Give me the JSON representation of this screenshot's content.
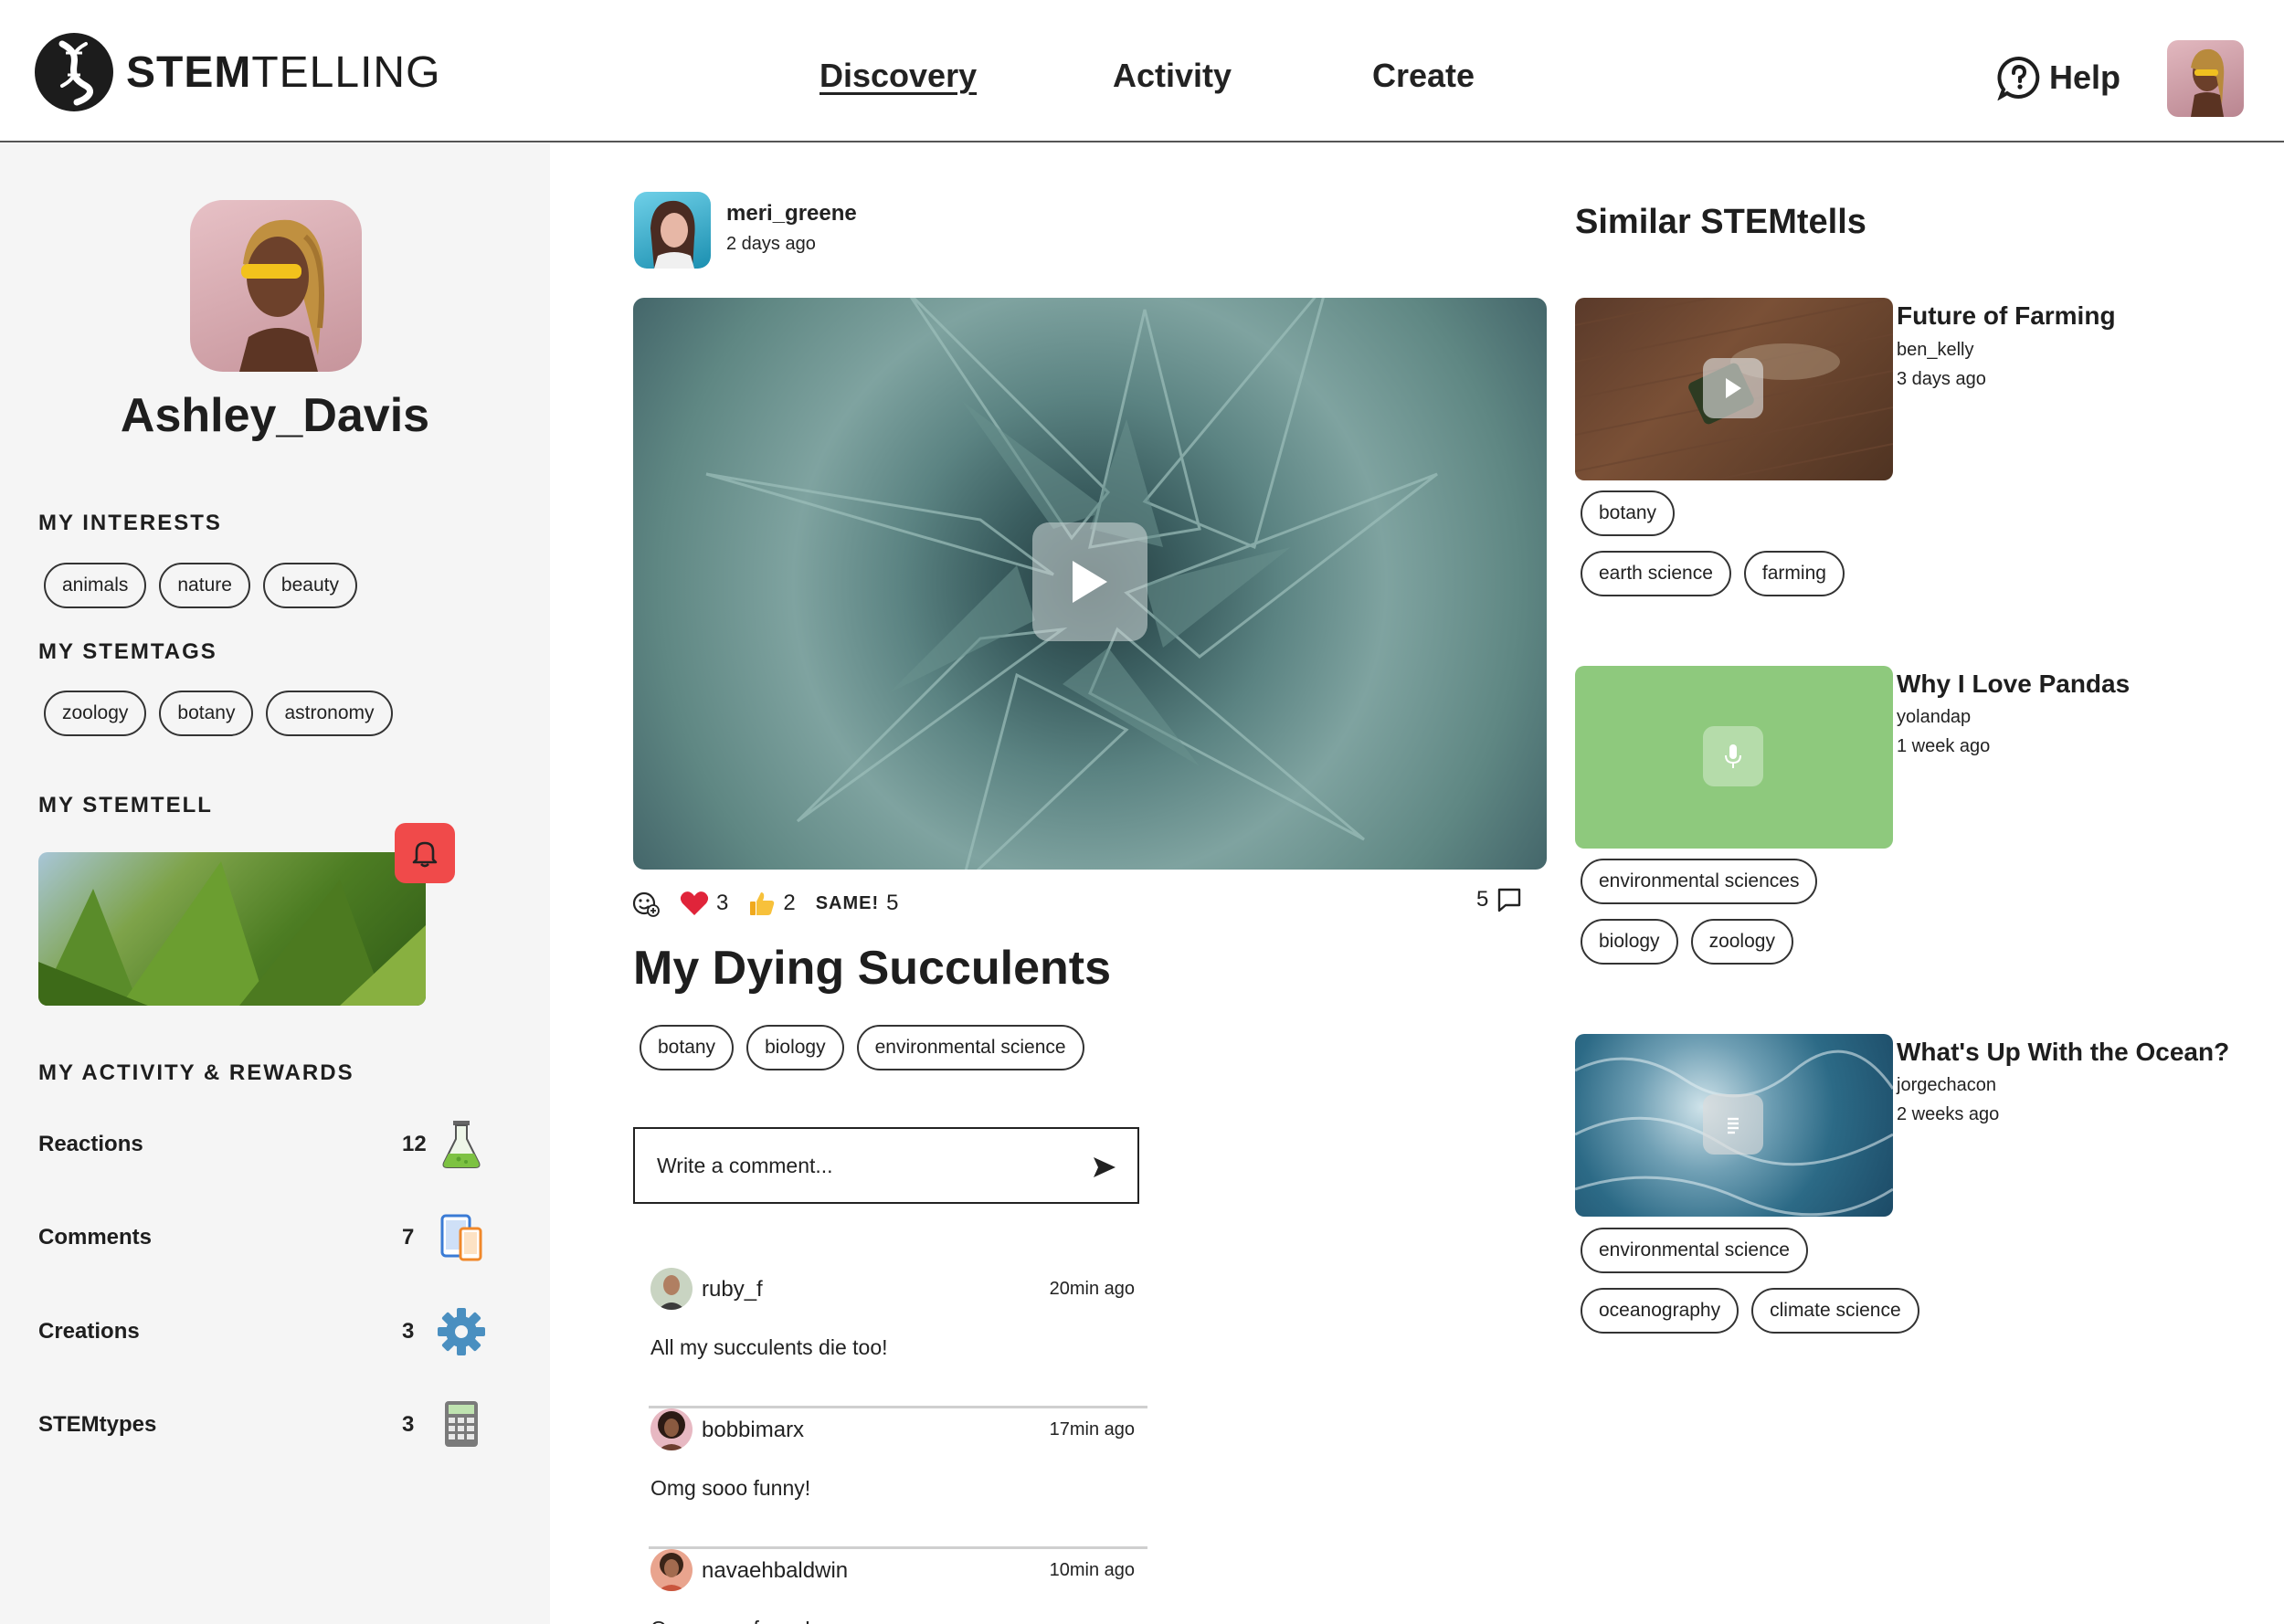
{
  "header": {
    "logo_bold": "STEM",
    "logo_light": "TELLING",
    "nav": [
      "Discovery",
      "Activity",
      "Create"
    ],
    "help_label": "Help"
  },
  "sidebar": {
    "profile_name": "Ashley_Davis",
    "interests_title": "MY INTERESTS",
    "interests": [
      "animals",
      "nature",
      "beauty"
    ],
    "stemtags_title": "MY STEMTAGS",
    "stemtags": [
      "zoology",
      "botany",
      "astronomy"
    ],
    "stemtell_title": "MY STEMTELL",
    "activity_title": "MY ACTIVITY & REWARDS",
    "rewards": [
      {
        "label": "Reactions",
        "count": "12",
        "icon": "flask-icon"
      },
      {
        "label": "Comments",
        "count": "7",
        "icon": "devices-icon"
      },
      {
        "label": "Creations",
        "count": "3",
        "icon": "gear-icon"
      },
      {
        "label": "STEMtypes",
        "count": "3",
        "icon": "calculator-icon"
      }
    ]
  },
  "post": {
    "user": "meri_greene",
    "time": "2 days ago",
    "reactions": {
      "heart": "3",
      "thumbs": "2",
      "same_label": "SAME!",
      "same": "5"
    },
    "comment_count": "5",
    "title": "My Dying Succulents",
    "tags": [
      "botany",
      "biology",
      "environmental science"
    ],
    "comment_placeholder": "Write a comment...",
    "comments": [
      {
        "user": "ruby_f",
        "time": "20min ago",
        "text": "All my succulents die too!"
      },
      {
        "user": "bobbimarx",
        "time": "17min ago",
        "text": "Omg sooo funny!"
      },
      {
        "user": "navaehbaldwin",
        "time": "10min ago",
        "text": "Omg sooo funny!"
      }
    ]
  },
  "similar": {
    "title": "Similar STEMtells",
    "items": [
      {
        "name": "Future of Farming",
        "author": "ben_kelly",
        "time": "3 days ago",
        "tags_row1": [
          "botany"
        ],
        "tags_row2": [
          "earth science",
          "farming"
        ],
        "media": "video"
      },
      {
        "name": "Why I Love Pandas",
        "author": "yolandap",
        "time": "1 week ago",
        "tags_row1": [
          "environmental sciences"
        ],
        "tags_row2": [
          "biology",
          "zoology"
        ],
        "media": "audio"
      },
      {
        "name": "What's Up With the Ocean?",
        "author": "jorgechacon",
        "time": "2 weeks ago",
        "tags_row1": [
          "environmental science"
        ],
        "tags_row2": [
          "oceanography",
          "climate science"
        ],
        "media": "text"
      }
    ]
  },
  "colors": {
    "accent_red": "#f04a4a",
    "panda_green": "#8ec97d",
    "sidebar_bg": "#f5f5f5"
  }
}
